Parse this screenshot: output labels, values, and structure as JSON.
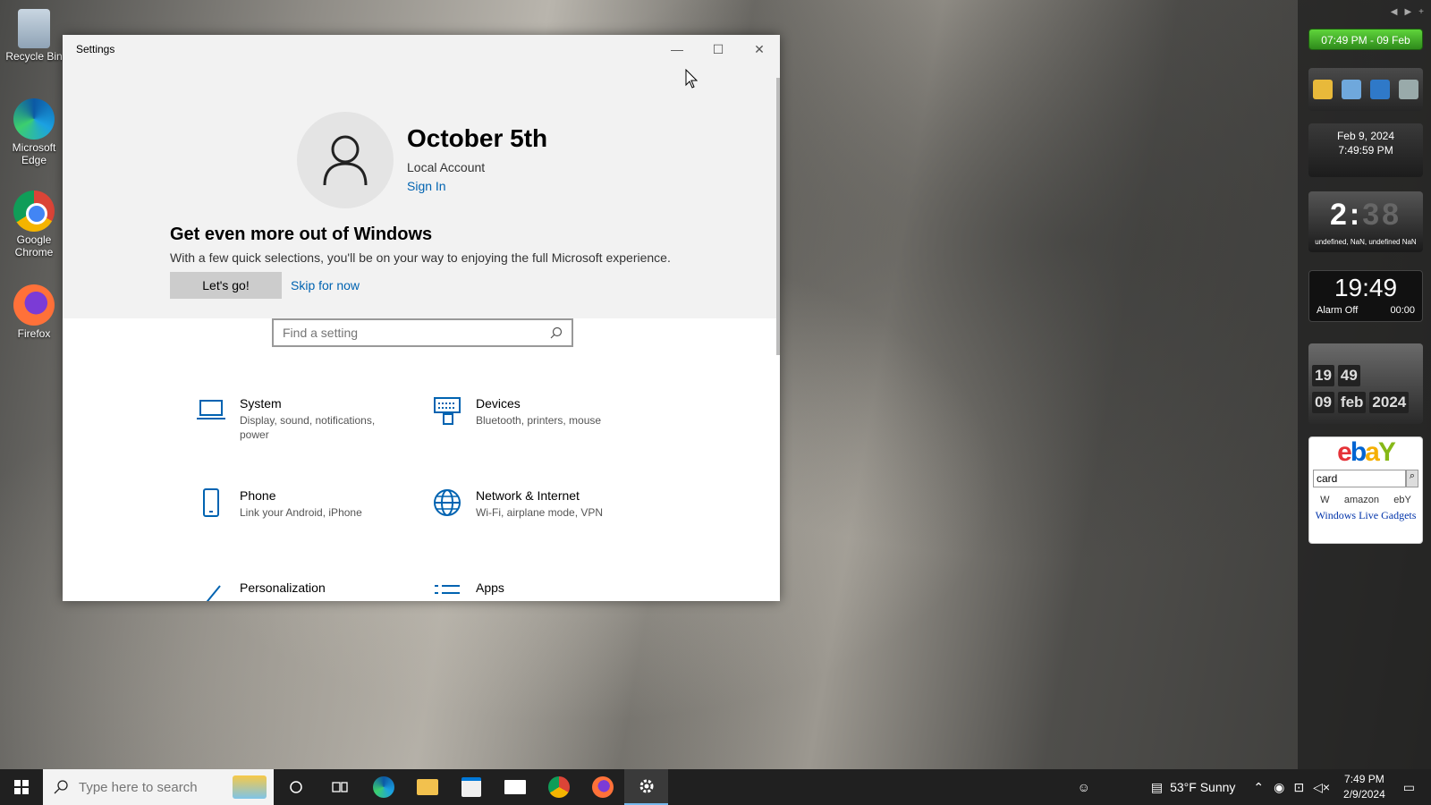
{
  "desktop": {
    "icons": [
      {
        "label": "Recycle Bin"
      },
      {
        "label": "Microsoft Edge"
      },
      {
        "label": "Google Chrome"
      },
      {
        "label": "Firefox"
      }
    ]
  },
  "window": {
    "title": "Settings",
    "minimize": "—",
    "maximize": "☐",
    "close": "✕"
  },
  "account": {
    "name": "October 5th",
    "type": "Local Account",
    "sign_in": "Sign In"
  },
  "promo": {
    "title": "Get even more out of Windows",
    "description": "With a few quick selections, you'll be on your way to enjoying the full Microsoft experience.",
    "primary_button": "Let's go!",
    "secondary_link": "Skip for now"
  },
  "search": {
    "placeholder": "Find a setting"
  },
  "categories": [
    {
      "name": "System",
      "description": "Display, sound, notifications, power",
      "icon": "laptop-icon"
    },
    {
      "name": "Devices",
      "description": "Bluetooth, printers, mouse",
      "icon": "keyboard-icon"
    },
    {
      "name": "Phone",
      "description": "Link your Android, iPhone",
      "icon": "phone-icon"
    },
    {
      "name": "Network & Internet",
      "description": "Wi-Fi, airplane mode, VPN",
      "icon": "globe-icon"
    },
    {
      "name": "Personalization",
      "description": "",
      "icon": "brush-icon"
    },
    {
      "name": "Apps",
      "description": "",
      "icon": "apps-list-icon"
    }
  ],
  "gadgets": {
    "green_clock": "07:49 PM - 09 Feb",
    "date_gadget": {
      "date": "Feb 9, 2024",
      "time": "7:49:59 PM"
    },
    "digital_clock": {
      "time": "2:",
      "seconds": "38",
      "status": "undefined, NaN, undefined NaN"
    },
    "alarm_clock": {
      "time": "19:49",
      "alarm": "Alarm Off",
      "alarm_time": "00:00"
    },
    "flip_clock": {
      "hour": "19",
      "minute": "49",
      "day": "09",
      "month": "feb",
      "year": "2024"
    },
    "ebay": {
      "search_value": "card",
      "engines": [
        "W",
        "amazon",
        "ebY"
      ],
      "footer": "Windows Live Gadgets"
    }
  },
  "taskbar": {
    "search_placeholder": "Type here to search",
    "weather": "53°F  Sunny",
    "time": "7:49 PM",
    "date": "2/9/2024"
  }
}
